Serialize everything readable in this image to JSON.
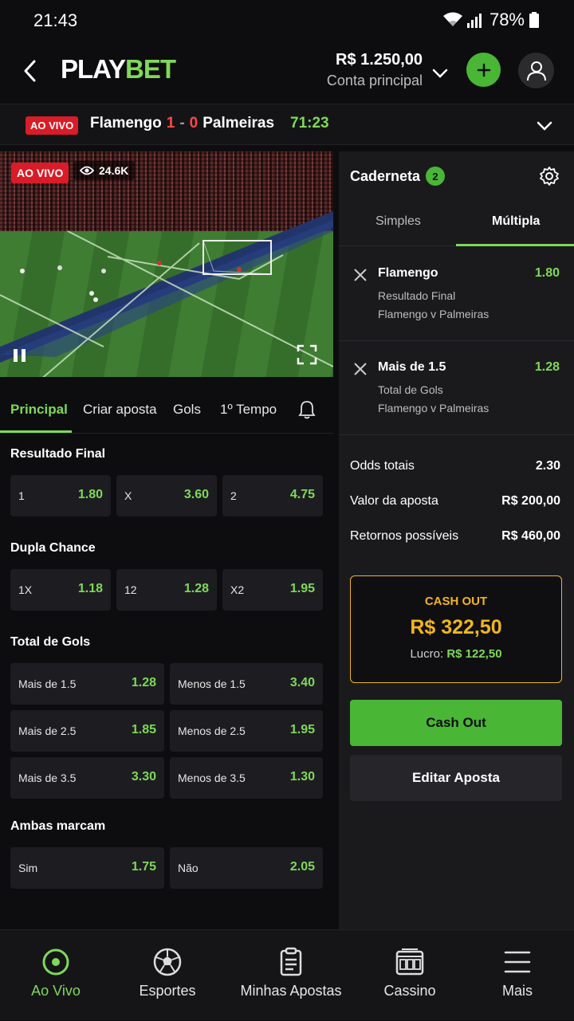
{
  "status": {
    "time": "21:43",
    "battery": "78%"
  },
  "header": {
    "logo_a": "PLAY",
    "logo_b": "BET",
    "balance": "R$ 1.250,00",
    "account": "Conta principal"
  },
  "match": {
    "live": "AO VIVO",
    "home": "Flamengo",
    "home_score": "1",
    "sep": "-",
    "away_score": "0",
    "away": "Palmeiras",
    "minute": "71:23"
  },
  "video": {
    "live": "AO VIVO",
    "views": "24.6K"
  },
  "tabs": [
    "Principal",
    "Criar aposta",
    "Gols",
    "1º Tempo"
  ],
  "markets": {
    "resultado": {
      "title": "Resultado Final",
      "odds": [
        {
          "label": "1",
          "value": "1.80"
        },
        {
          "label": "X",
          "value": "3.60"
        },
        {
          "label": "2",
          "value": "4.75"
        }
      ]
    },
    "dupla": {
      "title": "Dupla Chance",
      "odds": [
        {
          "label": "1X",
          "value": "1.18"
        },
        {
          "label": "12",
          "value": "1.28"
        },
        {
          "label": "X2",
          "value": "1.95"
        }
      ]
    },
    "gols": {
      "title": "Total de Gols",
      "odds": [
        {
          "label": "Mais de 1.5",
          "value": "1.28"
        },
        {
          "label": "Menos de 1.5",
          "value": "3.40"
        },
        {
          "label": "Mais de 2.5",
          "value": "1.85"
        },
        {
          "label": "Menos de 2.5",
          "value": "1.95"
        },
        {
          "label": "Mais de 3.5",
          "value": "3.30"
        },
        {
          "label": "Menos de 3.5",
          "value": "1.30"
        }
      ]
    },
    "ambas": {
      "title": "Ambas marcam",
      "odds": [
        {
          "label": "Sim",
          "value": "1.75"
        },
        {
          "label": "Não",
          "value": "2.05"
        }
      ]
    }
  },
  "slip": {
    "title": "Caderneta",
    "count": "2",
    "tab_simple": "Simples",
    "tab_multiple": "Múltipla",
    "selections": [
      {
        "name": "Flamengo",
        "odd": "1.80",
        "market": "Resultado Final",
        "event": "Flamengo v Palmeiras"
      },
      {
        "name": "Mais de 1.5",
        "odd": "1.28",
        "market": "Total de Gols",
        "event": "Flamengo v Palmeiras"
      }
    ],
    "summary": [
      {
        "label": "Odds totais",
        "value": "2.30"
      },
      {
        "label": "Valor da aposta",
        "value": "R$ 200,00"
      },
      {
        "label": "Retornos possíveis",
        "value": "R$ 460,00"
      }
    ],
    "cashout": {
      "title": "CASH OUT",
      "amount": "R$ 322,50",
      "lucro_label": "Lucro:",
      "lucro_value": "R$ 122,50"
    },
    "btn_cashout": "Cash Out",
    "btn_edit": "Editar Aposta"
  },
  "nav": [
    {
      "label": "Ao Vivo",
      "icon": "live-icon"
    },
    {
      "label": "Esportes",
      "icon": "soccer-ball-icon"
    },
    {
      "label": "Minhas Apostas",
      "icon": "clipboard-icon"
    },
    {
      "label": "Cassino",
      "icon": "slot-machine-icon"
    },
    {
      "label": "Mais",
      "icon": "menu-icon"
    }
  ],
  "colors": {
    "accent": "#7ed957",
    "accent_button": "#49b636",
    "live_red": "#d91c28",
    "cashout_gold": "#f2b51c"
  }
}
